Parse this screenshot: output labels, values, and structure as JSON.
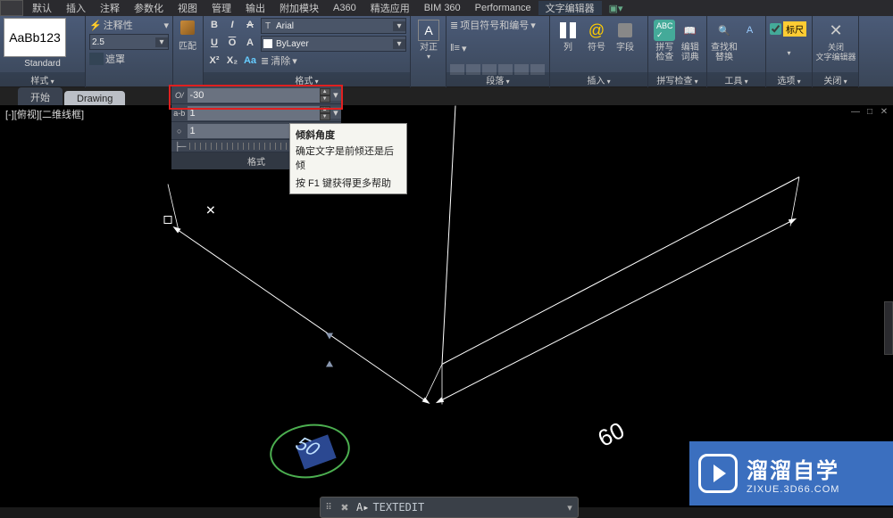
{
  "menubar": {
    "items": [
      "默认",
      "插入",
      "注释",
      "参数化",
      "视图",
      "管理",
      "输出",
      "附加模块",
      "A360",
      "精选应用",
      "BIM 360",
      "Performance",
      "文字编辑器"
    ]
  },
  "ribbon": {
    "style": {
      "preview": "AaBb123",
      "name": "Standard",
      "title": "样式"
    },
    "annotative": {
      "label": "注释性",
      "height": "2.5",
      "mask": "遮罩"
    },
    "match": {
      "label": "匹配"
    },
    "format": {
      "font": "Arial",
      "layer": "ByLayer",
      "bold": "B",
      "italic": "I",
      "strike": "A",
      "underline": "U",
      "overline": "O",
      "upper": "A",
      "sub": "X²",
      "sup": "X₂",
      "aa": "Aa",
      "clear": "清除",
      "title": "格式"
    },
    "align": {
      "label": "对正",
      "sym": "A"
    },
    "paragraph": {
      "bullets": "项目符号和编号",
      "title": "段落"
    },
    "insert": {
      "col": "列",
      "sym": "符号",
      "field": "字段",
      "title": "插入"
    },
    "spell": {
      "btn": "拼写\n检查",
      "dict": "编辑\n词典",
      "title": "拼写检查"
    },
    "tools": {
      "find": "查找和\n替换",
      "title": "工具"
    },
    "options": {
      "ruler": "标尺",
      "title": "选项"
    },
    "close": {
      "btn": "关闭\n文字编辑器",
      "title": "关闭"
    }
  },
  "filetabs": {
    "start": "开始",
    "drawing": "Drawing"
  },
  "format_panel": {
    "oblique_label": "O/",
    "oblique": "-30",
    "tracking_label": "a-b",
    "tracking": "1",
    "width_label": "○",
    "width": "1",
    "footer": "格式"
  },
  "tooltip": {
    "title": "倾斜角度",
    "body": "确定文字是前倾还是后倾",
    "f1": "按 F1 键获得更多帮助"
  },
  "viewport": {
    "label": "[-][俯视][二维线框]"
  },
  "drawing": {
    "dim_right": "60",
    "dim_left": "50"
  },
  "cmd": {
    "prompt": "A▸",
    "text": "TEXTEDIT"
  },
  "watermark": {
    "brand": "溜溜自学",
    "url": "ZIXUE.3D66.COM"
  }
}
